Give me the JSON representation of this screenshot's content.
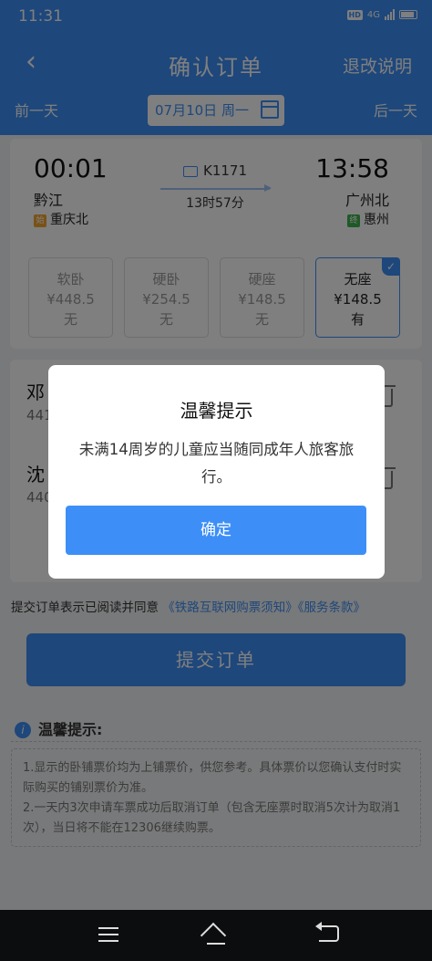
{
  "status_bar": {
    "time": "11:31",
    "network": "4G",
    "hd": "HD"
  },
  "header": {
    "back_glyph": "‹",
    "title": "确认订单",
    "explain_link": "退改说明",
    "prev_day": "前一天",
    "next_day": "后一天",
    "date": "07月10日 周一"
  },
  "train": {
    "number": "K1171",
    "depart_time": "00:01",
    "depart_station": "黔江",
    "arrive_time": "13:58",
    "arrive_station": "广州北",
    "duration": "13时57分",
    "from_station": "重庆北",
    "from_badge": "始",
    "to_station": "惠州",
    "to_badge": "终"
  },
  "seats": [
    {
      "type": "软卧",
      "price": "¥448.5",
      "avail": "无",
      "selected": false
    },
    {
      "type": "硬卧",
      "price": "¥254.5",
      "avail": "无",
      "selected": false
    },
    {
      "type": "硬座",
      "price": "¥148.5",
      "avail": "无",
      "selected": false
    },
    {
      "type": "无座",
      "price": "¥148.5",
      "avail": "有",
      "selected": true
    }
  ],
  "passengers": [
    {
      "name": "邓",
      "id_partial": "441"
    },
    {
      "name": "沈",
      "id_partial": "440"
    }
  ],
  "agreement": {
    "prefix": "提交订单表示已阅读并同意",
    "link1": "《铁路互联网购票须知》",
    "link2": "《服务条款》"
  },
  "submit_label": "提交订单",
  "tips": {
    "heading": "温馨提示:",
    "info_glyph": "i",
    "lines": [
      "1.显示的卧铺票价均为上铺票价，供您参考。具体票价以您确认支付时实际购买的铺别票价为准。",
      "2.一天内3次申请车票成功后取消订单（包含无座票时取消5次计为取消1次），当日将不能在12306继续购票。"
    ]
  },
  "dialog": {
    "title": "温馨提示",
    "message": "未满14周岁的儿童应当随同成年人旅客旅行。",
    "confirm_label": "确定"
  },
  "colors": {
    "accent": "#3d8ff7",
    "overlay": "rgba(0,0,0,0.5)"
  }
}
